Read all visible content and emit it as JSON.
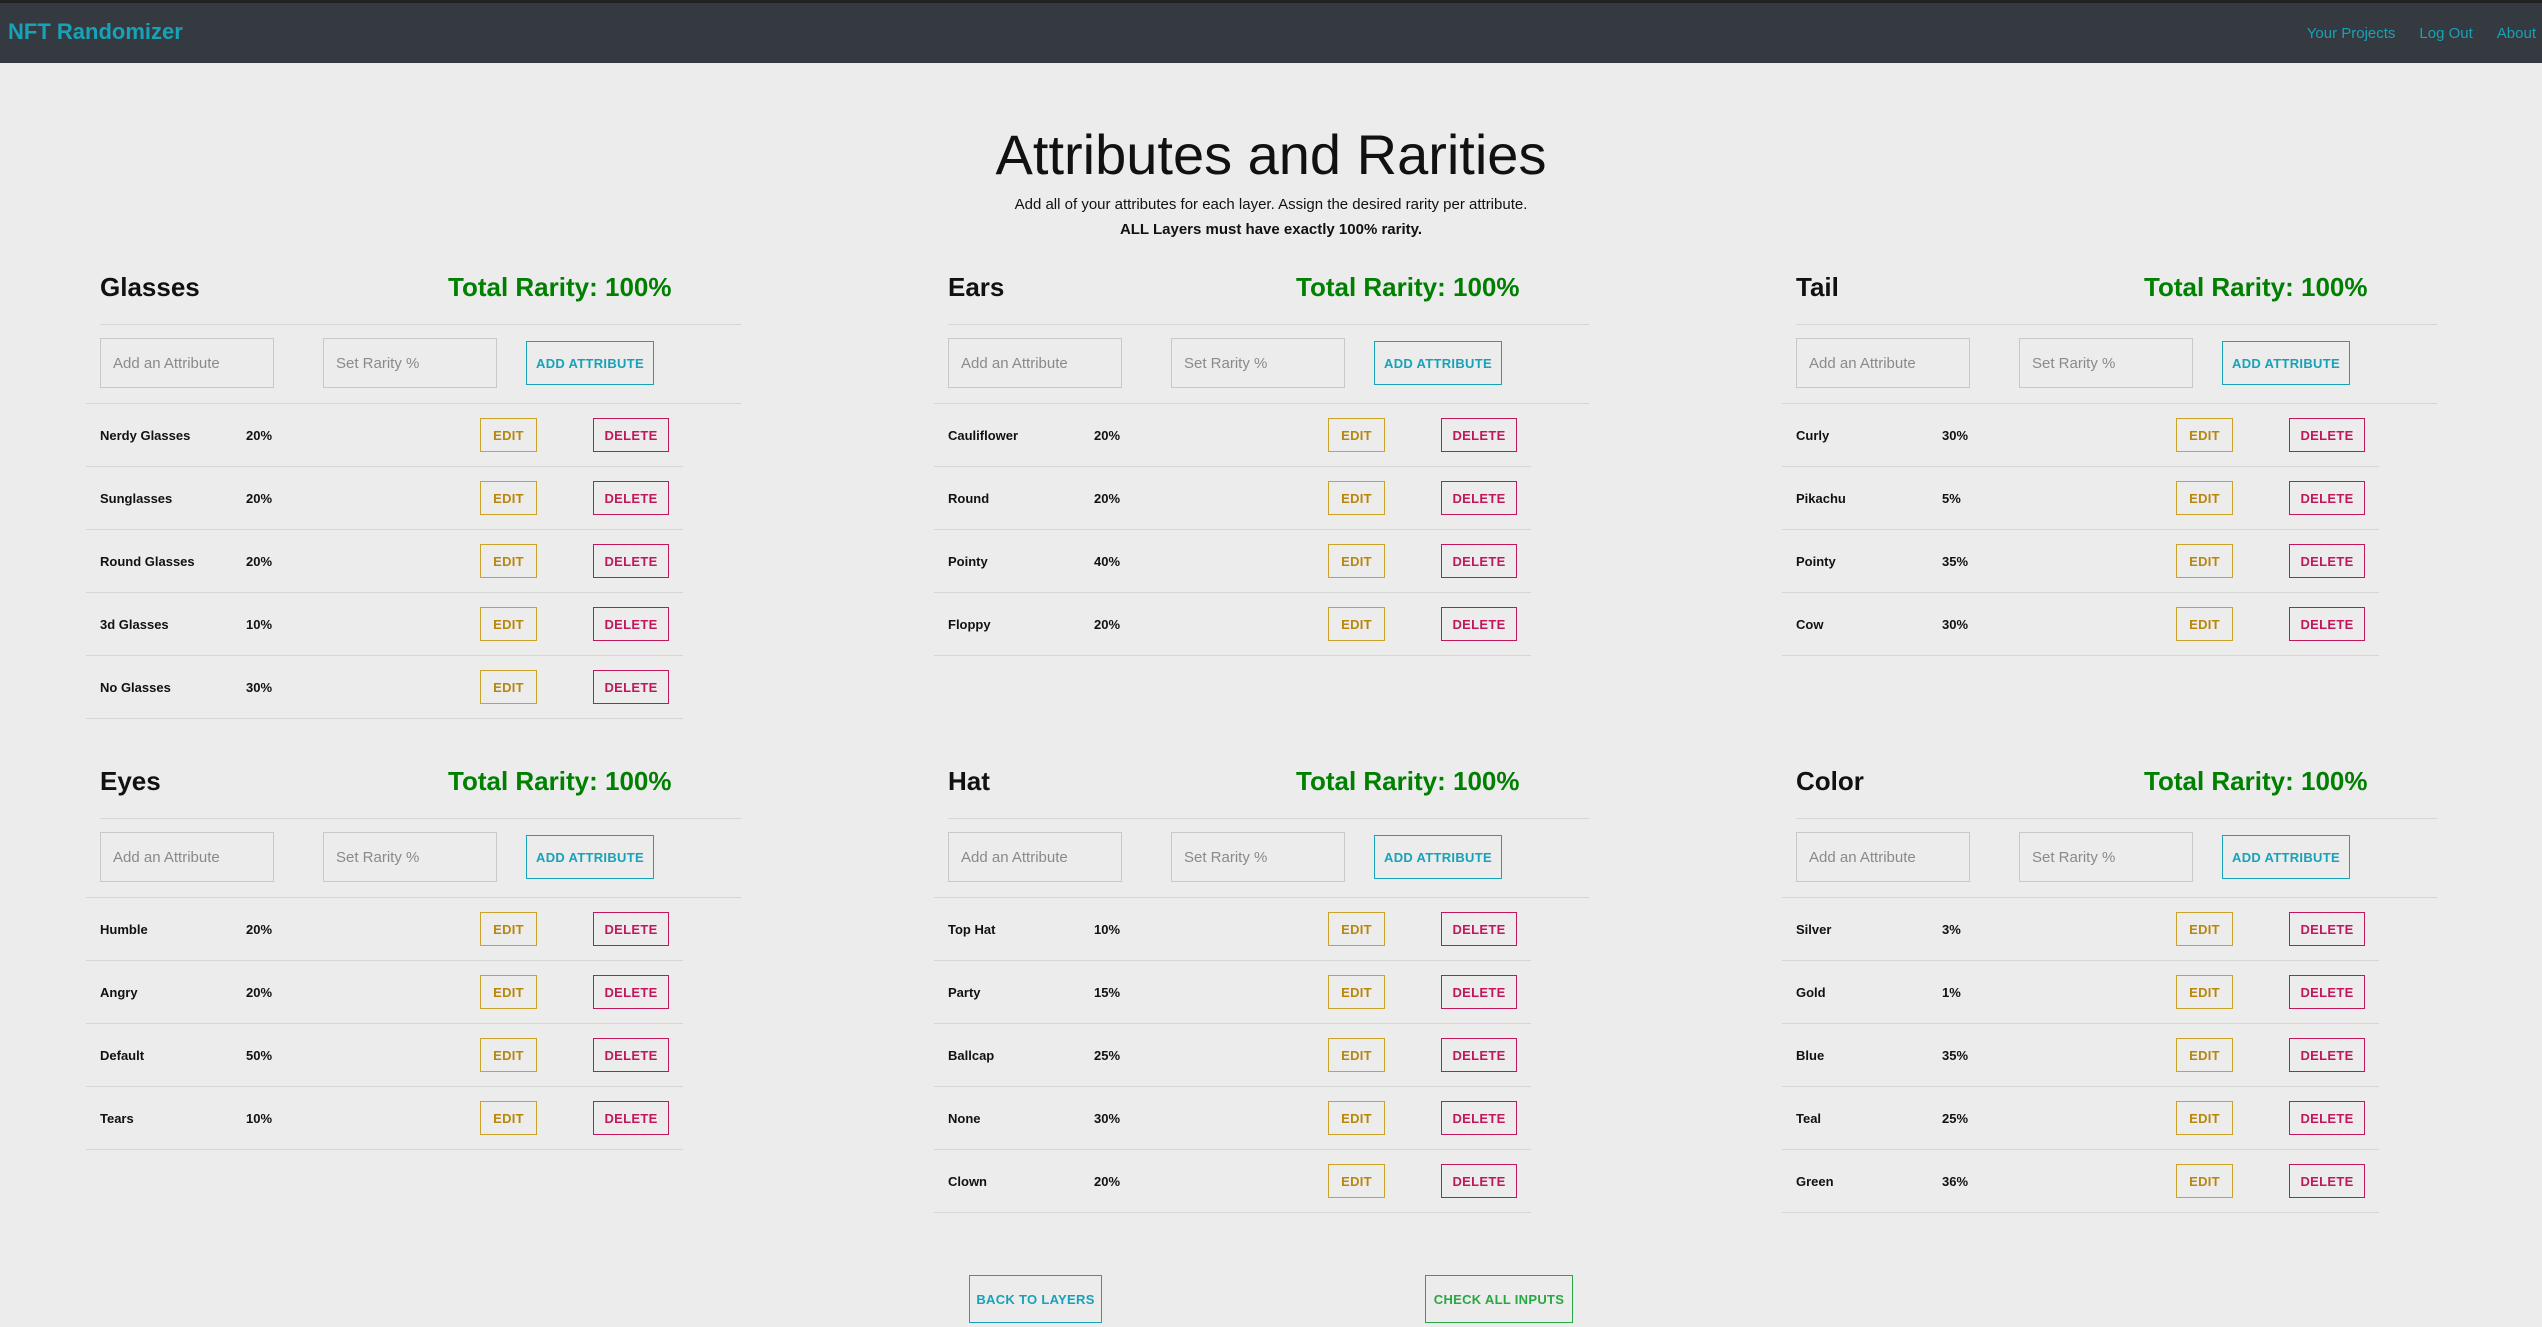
{
  "nav": {
    "brand": "NFT Randomizer",
    "links": [
      "Your Projects",
      "Log Out",
      "About"
    ]
  },
  "header": {
    "title": "Attributes and Rarities",
    "subtitle": "Add all of your attributes for each layer. Assign the desired rarity per attribute.",
    "note": "ALL Layers must have exactly 100% rarity."
  },
  "labels": {
    "attr_placeholder": "Add an Attribute",
    "rarity_placeholder": "Set Rarity %",
    "add_button": "ADD ATTRIBUTE",
    "edit_button": "EDIT",
    "delete_button": "DELETE",
    "back_button": "BACK TO LAYERS",
    "check_button": "CHECK ALL INPUTS"
  },
  "layers": [
    {
      "name": "Glasses",
      "total": "Total Rarity: 100%",
      "attributes": [
        {
          "name": "Nerdy Glasses",
          "rarity": "20%"
        },
        {
          "name": "Sunglasses",
          "rarity": "20%"
        },
        {
          "name": "Round Glasses",
          "rarity": "20%"
        },
        {
          "name": "3d Glasses",
          "rarity": "10%"
        },
        {
          "name": "No Glasses",
          "rarity": "30%"
        }
      ]
    },
    {
      "name": "Ears",
      "total": "Total Rarity: 100%",
      "attributes": [
        {
          "name": "Cauliflower",
          "rarity": "20%"
        },
        {
          "name": "Round",
          "rarity": "20%"
        },
        {
          "name": "Pointy",
          "rarity": "40%"
        },
        {
          "name": "Floppy",
          "rarity": "20%"
        }
      ]
    },
    {
      "name": "Tail",
      "total": "Total Rarity: 100%",
      "attributes": [
        {
          "name": "Curly",
          "rarity": "30%"
        },
        {
          "name": "Pikachu",
          "rarity": "5%"
        },
        {
          "name": "Pointy",
          "rarity": "35%"
        },
        {
          "name": "Cow",
          "rarity": "30%"
        }
      ]
    },
    {
      "name": "Eyes",
      "total": "Total Rarity: 100%",
      "attributes": [
        {
          "name": "Humble",
          "rarity": "20%"
        },
        {
          "name": "Angry",
          "rarity": "20%"
        },
        {
          "name": "Default",
          "rarity": "50%"
        },
        {
          "name": "Tears",
          "rarity": "10%"
        }
      ]
    },
    {
      "name": "Hat",
      "total": "Total Rarity: 100%",
      "attributes": [
        {
          "name": "Top Hat",
          "rarity": "10%"
        },
        {
          "name": "Party",
          "rarity": "15%"
        },
        {
          "name": "Ballcap",
          "rarity": "25%"
        },
        {
          "name": "None",
          "rarity": "30%"
        },
        {
          "name": "Clown",
          "rarity": "20%"
        }
      ]
    },
    {
      "name": "Color",
      "total": "Total Rarity: 100%",
      "attributes": [
        {
          "name": "Silver",
          "rarity": "3%"
        },
        {
          "name": "Gold",
          "rarity": "1%"
        },
        {
          "name": "Blue",
          "rarity": "35%"
        },
        {
          "name": "Teal",
          "rarity": "25%"
        },
        {
          "name": "Green",
          "rarity": "36%"
        }
      ]
    }
  ],
  "colors": {
    "navbar": "#343a40",
    "brand": "#17a2b8",
    "total_green": "#008000",
    "edit": "#b8860b",
    "delete": "#c2185b",
    "check": "#28a745"
  }
}
